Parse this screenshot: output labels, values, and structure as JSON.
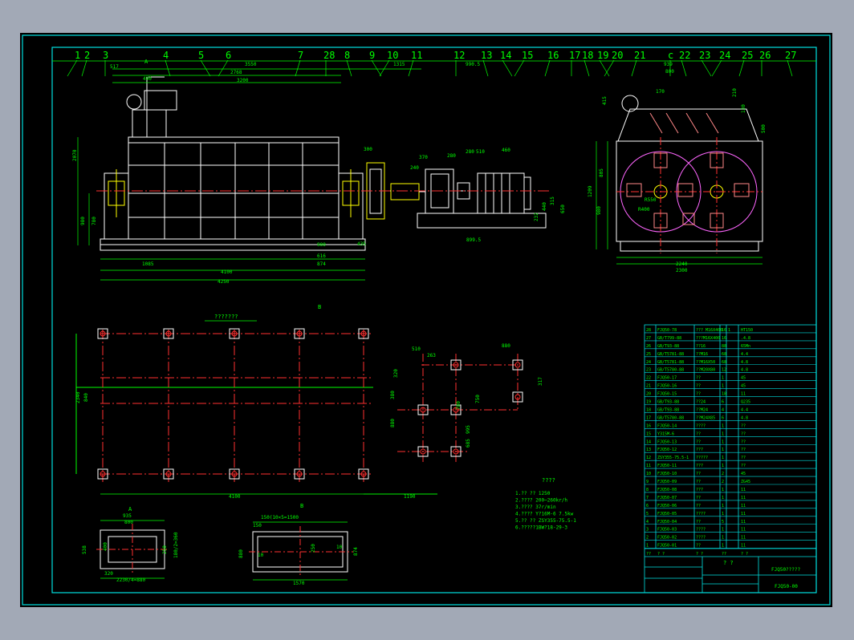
{
  "colors": {
    "background": "#a2a9b6",
    "paper": "#000000",
    "frame": "#00e0e0",
    "line": "#ffffff",
    "dim": "#00ff00",
    "center": "#ff3030",
    "part": "#ff66ff",
    "hatch": "#ffff00",
    "blade": "#ff8888"
  },
  "balloons": [
    "1",
    "2",
    "3",
    "4",
    "5",
    "6",
    "7",
    "28",
    "8",
    "9",
    "10",
    "11",
    "12",
    "13",
    "14",
    "15",
    "16",
    "17",
    "18",
    "19",
    "20",
    "21",
    "c",
    "22",
    "23",
    "24",
    "25",
    "26",
    "27"
  ],
  "front_view": {
    "dims_top": [
      "517",
      "490",
      "3550",
      "2768",
      "3200",
      "1315",
      "990.5"
    ],
    "dims_bottom": [
      "1085",
      "4100",
      "4250",
      "900",
      "616",
      "874",
      "435"
    ],
    "dims_left": [
      "2070",
      "980",
      "780"
    ],
    "dims_drive": [
      "370",
      "280",
      "240",
      "300",
      "280",
      "510",
      "460",
      "899.5",
      "315",
      "650",
      "232",
      "440"
    ],
    "label_a": "A",
    "label_b": "B"
  },
  "side_view": {
    "dims": [
      "939",
      "800",
      "170",
      "415",
      "210",
      "130",
      "500",
      "805",
      "1209",
      "980",
      "2240",
      "2300",
      "R400",
      "R550"
    ]
  },
  "plan": {
    "title": "???????",
    "dims": [
      "4100",
      "1190",
      "2340",
      "840",
      "510",
      "263",
      "880",
      "750",
      "317",
      "320",
      "380",
      "880",
      "995",
      "685",
      "780"
    ],
    "label_b": "B"
  },
  "detail_a": {
    "label": "A",
    "dims": [
      "935",
      "800",
      "320",
      "2230/4=880",
      "538",
      "400",
      "250",
      "180/2=360"
    ]
  },
  "detail_b": {
    "label": "B",
    "dims": [
      "150(10×5=1500",
      "1570",
      "150",
      "10",
      "10",
      "874",
      "880",
      "250"
    ]
  },
  "notes": {
    "title": "????",
    "lines": [
      "1.?? ?? 1250",
      "2.???? 200~260kr/h",
      "3.???? 37r/min",
      "4.???? Y?16M-6 7.5kw",
      "5.?? ?? ZSY355-75.5-1",
      "6.?????1BW?18-29-3"
    ]
  },
  "bom": {
    "rows": [
      [
        "28",
        "FJQ50-78",
        "??? M16X400",
        "16",
        "1",
        "HT150"
      ],
      [
        "27",
        "GB/T799-88",
        "???M16X400",
        "16",
        "",
        ".4.8"
      ],
      [
        "26",
        "GB/T93-88",
        "??16",
        "88",
        "",
        "65Mn"
      ],
      [
        "25",
        "GB/T5781-88",
        "??M16",
        "68",
        "",
        "4.4"
      ],
      [
        "24",
        "GB/T5781-88",
        "??M16X50",
        "68",
        "",
        "4.8"
      ],
      [
        "23",
        "GB/T5780-88",
        "??M20X80",
        "12",
        "",
        "4.8"
      ],
      [
        "22",
        "FJQ50-17",
        "??",
        "1",
        "",
        "45"
      ],
      [
        "21",
        "FJQ50-16",
        "??",
        "1",
        "",
        "45"
      ],
      [
        "20",
        "FJQ50-15",
        "??",
        "18",
        "",
        "11"
      ],
      [
        "19",
        "GB/T93-88",
        "??24",
        "6",
        "",
        "Q235"
      ],
      [
        "18",
        "GB/T93-88",
        "??M24",
        "4",
        "",
        "4.4"
      ],
      [
        "17",
        "GB/T5780-88",
        "??M24X85",
        "6",
        "",
        "4.8"
      ],
      [
        "16",
        "FJQ50-14",
        "????",
        "1",
        "",
        "??"
      ],
      [
        "15",
        "Y315M-6",
        "??",
        "1",
        "",
        "??"
      ],
      [
        "14",
        "FJQ50-13",
        "??",
        "1",
        "",
        "??"
      ],
      [
        "13",
        "FJQ50-12",
        "???",
        "1",
        "",
        "??"
      ],
      [
        "12",
        "ZSY355-75.5-1",
        "?????",
        "1",
        "",
        "??"
      ],
      [
        "11",
        "FJQ50-11",
        "???",
        "1",
        "",
        "??"
      ],
      [
        "10",
        "FJQ50-10",
        "??",
        "2",
        "",
        "45"
      ],
      [
        "9",
        "FJQ50-09",
        "??",
        "2",
        "",
        "ZG45"
      ],
      [
        "8",
        "FJQ50-08",
        "???",
        "1",
        "",
        "11"
      ],
      [
        "7",
        "FJQ50-07",
        "??",
        "1",
        "",
        "11"
      ],
      [
        "6",
        "FJQ50-06",
        "??",
        "1",
        "",
        "11"
      ],
      [
        "5",
        "FJQ50-05",
        "????",
        "1",
        "",
        "11"
      ],
      [
        "4",
        "FJQ50-04",
        "??",
        "5",
        "",
        "11"
      ],
      [
        "3",
        "FJQ50-03",
        "????",
        "1",
        "",
        "11"
      ],
      [
        "2",
        "FJQ50-02",
        "????",
        "1",
        "",
        "11"
      ],
      [
        "1",
        "FJQ50-01",
        "??",
        "1",
        "",
        "11"
      ]
    ],
    "header_row": [
      "??",
      "? ?",
      "? ?",
      "??",
      "",
      "? ?"
    ],
    "title_center": "? ?",
    "title_name": "FJQ50?????",
    "drawing_no": "FJQ50-00"
  }
}
